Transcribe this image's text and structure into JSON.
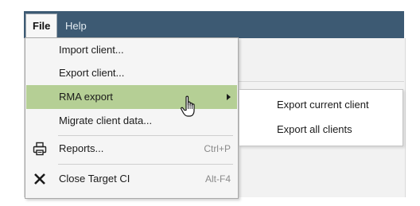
{
  "menubar": {
    "file_label": "File",
    "help_label": "Help"
  },
  "file_menu": {
    "items": [
      {
        "label": "Import client..."
      },
      {
        "label": "Export client..."
      },
      {
        "label": "RMA export",
        "has_submenu": true,
        "highlighted": true
      },
      {
        "label": "Migrate client data..."
      },
      {
        "label": "Reports...",
        "shortcut": "Ctrl+P",
        "icon": "printer-icon"
      },
      {
        "label": "Close Target CI",
        "shortcut": "Alt-F4",
        "icon": "close-icon"
      }
    ]
  },
  "rma_submenu": {
    "items": [
      {
        "label": "Export current client"
      },
      {
        "label": "Export all clients"
      }
    ]
  },
  "colors": {
    "menubar_bg": "#3d5a73",
    "highlight_bg": "#b5cf95",
    "menu_bg": "#f5f5f5"
  }
}
